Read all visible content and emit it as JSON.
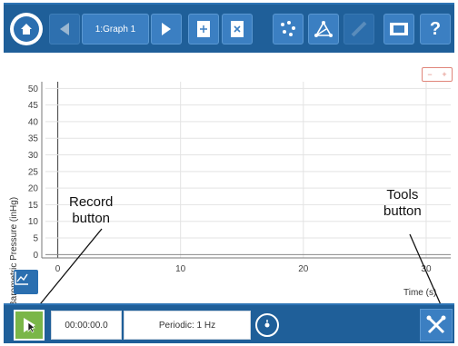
{
  "toolbar": {
    "graph_tab_label": "1:Graph 1",
    "help_label": "?",
    "icons": [
      "home-icon",
      "back-arrow-icon",
      "graph-tab",
      "forward-arrow-icon",
      "add-page-icon",
      "delete-page-icon",
      "data-points-icon",
      "connect-lines-icon",
      "disabled-icon",
      "camera-icon",
      "help-icon"
    ]
  },
  "graph": {
    "ylabel": "Barometric Pressure (inHg)",
    "xlabel": "Time (s)",
    "mini_controls": [
      "−",
      "+"
    ]
  },
  "annotations": {
    "record": "Record\nbutton",
    "tools": "Tools\nbutton"
  },
  "bottom": {
    "timer": "00:00:00.0",
    "sampling": "Periodic: 1 Hz"
  },
  "chart_data": {
    "type": "line",
    "xlabel": "Time (s)",
    "ylabel": "Barometric Pressure (inHg)",
    "xlim": [
      -1,
      32
    ],
    "ylim": [
      -1,
      52
    ],
    "xticks": [
      0,
      10,
      20,
      30
    ],
    "yticks": [
      0,
      5,
      10,
      15,
      20,
      25,
      30,
      35,
      40,
      45,
      50
    ],
    "grid": true,
    "series": []
  }
}
